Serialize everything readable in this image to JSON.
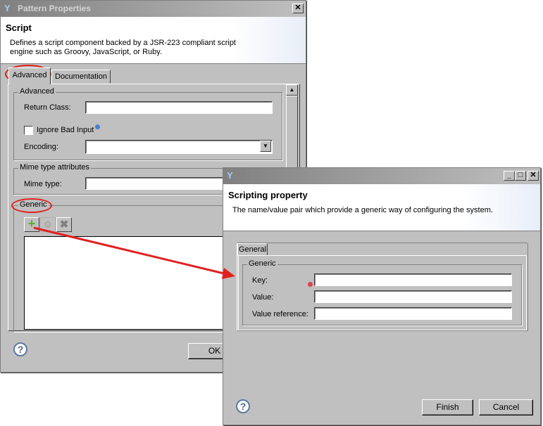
{
  "back_dialog": {
    "title": "Pattern Properties",
    "heading": "Script",
    "description_line1": "Defines a script component backed by a JSR-223 compliant script",
    "description_line2": "engine such as Groovy, JavaScript, or Ruby.",
    "tabs": [
      {
        "label": "Advanced",
        "active": true
      },
      {
        "label": "Documentation",
        "active": false
      }
    ],
    "advanced_group": {
      "label": "Advanced",
      "return_class_label": "Return Class:",
      "return_class_value": "",
      "ignore_bad_input_label": "Ignore Bad Input",
      "ignore_bad_input_checked": false,
      "encoding_label": "Encoding:",
      "encoding_value": ""
    },
    "mime_group": {
      "label": "Mime type attributes",
      "mime_type_label": "Mime type:",
      "mime_type_value": ""
    },
    "generic_group": {
      "label": "Generic"
    },
    "ok_label": "OK"
  },
  "front_dialog": {
    "heading": "Scripting property",
    "description": "The name/value pair which provide a generic way of configuring the system.",
    "tab_label": "General",
    "group_label": "Generic",
    "key_label": "Key:",
    "key_value": "",
    "value_label": "Value:",
    "value_value": "",
    "value_ref_label": "Value reference:",
    "value_ref_value": "",
    "finish_label": "Finish",
    "cancel_label": "Cancel"
  },
  "annotation_color": "#e02020"
}
